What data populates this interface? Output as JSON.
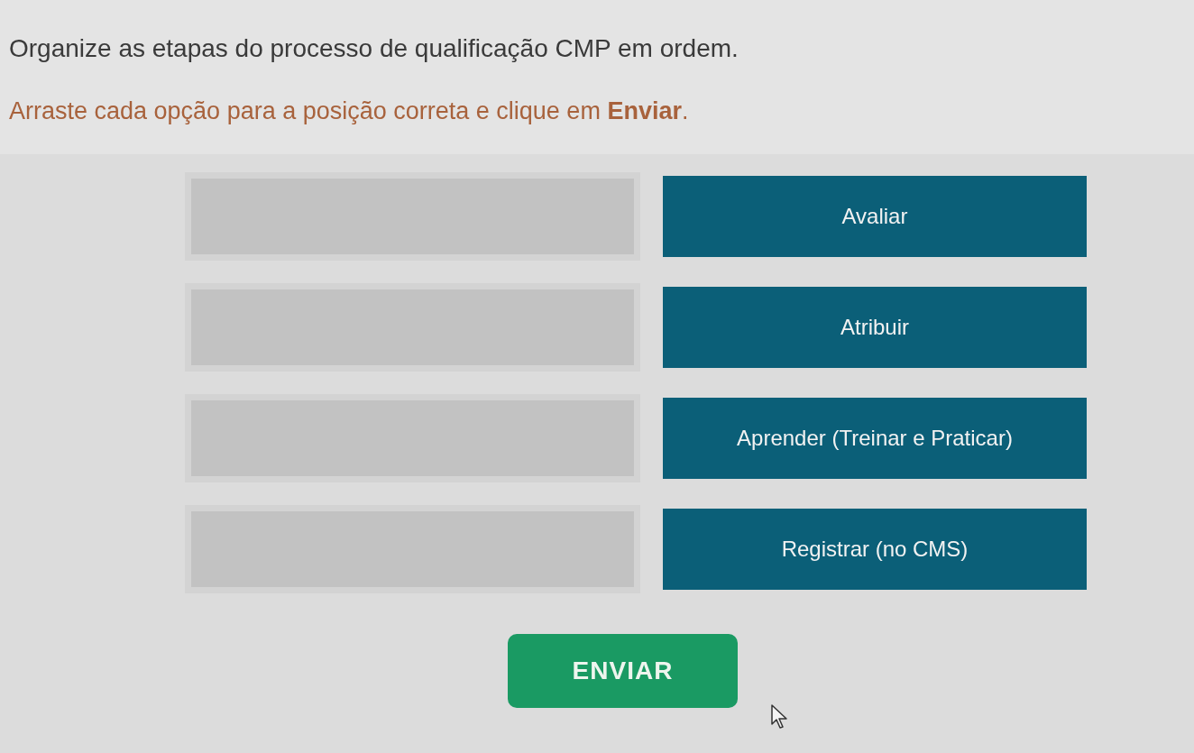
{
  "question": {
    "title": "Organize as etapas do processo de qualificação CMP em ordem.",
    "prompt": "Arraste cada opção para a posição correta e clique em **Enviar**."
  },
  "options": [
    {
      "label": "Avaliar"
    },
    {
      "label": "Atribuir"
    },
    {
      "label": "Aprender (Treinar e Praticar)"
    },
    {
      "label": "Registrar (no CMS)"
    }
  ],
  "submit_button": {
    "label": "ENVIAR"
  }
}
